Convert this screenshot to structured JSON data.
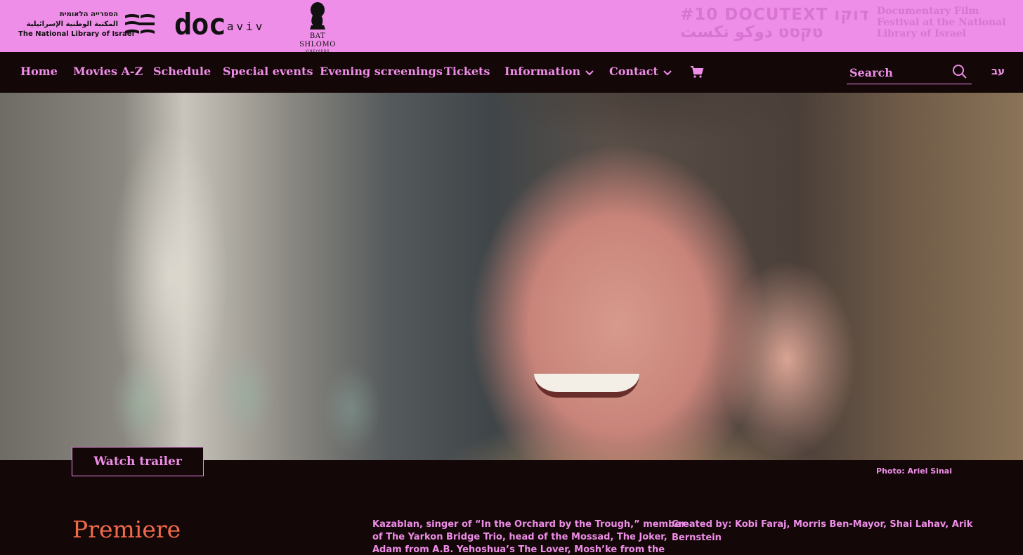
{
  "brand": {
    "nli_lines": [
      "הספרייה הלאומית",
      "المكتبة الوطنية الإسرائيلية",
      "The National Library of Israel"
    ],
    "docaviv_doc": "doc",
    "docaviv_aviv": "aviv",
    "batshlomo_name": "BAT SHLOMO",
    "batshlomo_sub": "VINEYARDS",
    "docutext_line1": "#10 DOCUTEXT דוקו",
    "docutext_line2": "טקסט دوكو تكست",
    "festival_lines": [
      "Documentary Film",
      "Festival at the National",
      "Library of Israel"
    ]
  },
  "nav": {
    "items": [
      "Home",
      "Movies A-Z",
      "Schedule",
      "Special events",
      "Evening screenings",
      "Tickets",
      "Information",
      "Contact"
    ],
    "cart_icon": "cart-icon",
    "search_placeholder": "Search",
    "language_toggle": "עב"
  },
  "hero": {
    "trailer_button": "Watch trailer",
    "photo_credit": "Photo: Ariel Sinai"
  },
  "content": {
    "premiere_label": "Premiere",
    "synopsis_lines": [
      "Kazablan, singer of “In the Orchard by the Trough,” member",
      "of The Yarkon Bridge Trio, head of the Mossad, The Joker,",
      "Adam from A.B. Yehoshua’s The Lover, Mosh’ke from the"
    ],
    "credits_lines": [
      "Created by: Kobi Faraj, Morris Ben-Mayor, Shai Lahav, Arik",
      "Bernstein"
    ]
  },
  "colors": {
    "brand_pink": "#ee8ee8",
    "background": "#140707",
    "accent_orange": "#f06a4a"
  }
}
